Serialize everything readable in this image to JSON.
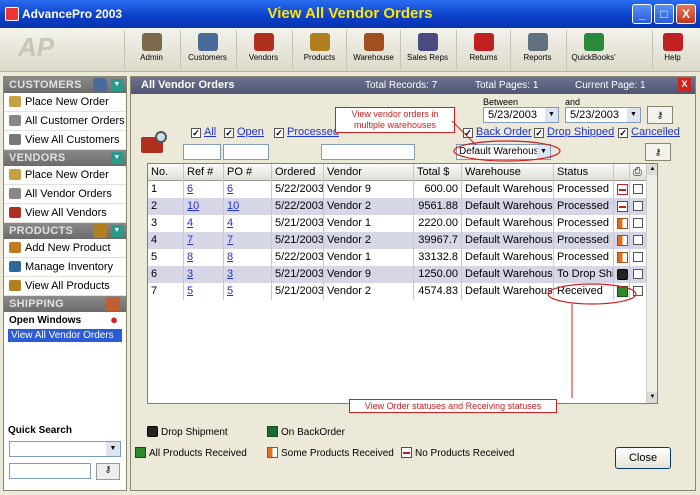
{
  "window": {
    "app_title": "AdvancePro 2003",
    "center_title": "View All Vendor Orders",
    "controls": [
      "_",
      "□",
      "X"
    ]
  },
  "toolbar": {
    "buttons": [
      {
        "label": "Admin",
        "icon": "admin-icon",
        "color": "#7b6a4e"
      },
      {
        "label": "Customers",
        "icon": "customers-icon",
        "color": "#4a6a9a"
      },
      {
        "label": "Vendors",
        "icon": "vendors-icon",
        "color": "#b03020"
      },
      {
        "label": "Products",
        "icon": "products-icon",
        "color": "#b08020"
      },
      {
        "label": "Warehouse",
        "icon": "warehouse-icon",
        "color": "#a05020"
      },
      {
        "label": "Sales Reps",
        "icon": "sales-reps-icon",
        "color": "#4a4a80"
      },
      {
        "label": "Returns",
        "icon": "returns-icon",
        "color": "#c02020"
      },
      {
        "label": "Reports",
        "icon": "reports-icon",
        "color": "#607080"
      },
      {
        "label": "QuickBooks'",
        "icon": "quickbooks-icon",
        "color": "#2a8a3a"
      },
      {
        "label": "Help",
        "icon": "help-icon",
        "color": "#c02020"
      }
    ]
  },
  "sidebar": {
    "customers": {
      "title": "CUSTOMERS",
      "items": [
        "Place New Order",
        "All Customer Orders",
        "View All Customers"
      ]
    },
    "vendors": {
      "title": "VENDORS",
      "items": [
        "Place New Order",
        "All Vendor Orders",
        "View All Vendors"
      ]
    },
    "products": {
      "title": "PRODUCTS",
      "items": [
        "Add New Product",
        "Manage Inventory",
        "View All Products"
      ]
    },
    "shipping": {
      "title": "SHIPPING"
    },
    "open_windows": {
      "title": "Open Windows",
      "items": [
        "View All Vendor Orders"
      ]
    },
    "quick_search": {
      "title": "Quick Search"
    }
  },
  "main": {
    "title": "All Vendor Orders",
    "total_records": "Total Records: 7",
    "total_pages": "Total Pages:  1",
    "current_page": "Current Page:  1",
    "between_label": "Between",
    "and_label": "and",
    "date_from": "5/23/2003",
    "date_to": "5/23/2003",
    "filters": [
      "All",
      "Open",
      "Processed",
      "Back Order",
      "Drop Shipped",
      "Cancelled"
    ],
    "warehouse_select": "Default Warehouse",
    "columns": [
      "No.",
      "Ref #",
      "PO #",
      "Ordered",
      "Vendor",
      "Total $",
      "Warehouse",
      "Status"
    ],
    "rows": [
      {
        "no": "1",
        "ref": "6",
        "po": "6",
        "ordered": "5/22/2003",
        "vendor": "Vendor 9",
        "total": "600.00",
        "warehouse": "Default Warehouse",
        "status": "Processed",
        "icon": "none"
      },
      {
        "no": "2",
        "ref": "10",
        "po": "10",
        "ordered": "5/22/2003",
        "vendor": "Vendor 2",
        "total": "9561.88",
        "warehouse": "Default Warehouse",
        "status": "Processed",
        "icon": "none"
      },
      {
        "no": "3",
        "ref": "4",
        "po": "4",
        "ordered": "5/21/2003",
        "vendor": "Vendor 1",
        "total": "2220.00",
        "warehouse": "Default Warehouse",
        "status": "Processed",
        "icon": "some"
      },
      {
        "no": "4",
        "ref": "7",
        "po": "7",
        "ordered": "5/21/2003",
        "vendor": "Vendor 2",
        "total": "39967.7",
        "warehouse": "Default Warehouse",
        "status": "Processed",
        "icon": "some"
      },
      {
        "no": "5",
        "ref": "8",
        "po": "8",
        "ordered": "5/22/2003",
        "vendor": "Vendor 1",
        "total": "33132.8",
        "warehouse": "Default Warehouse",
        "status": "Processed",
        "icon": "some"
      },
      {
        "no": "6",
        "ref": "3",
        "po": "3",
        "ordered": "5/21/2003",
        "vendor": "Vendor 9",
        "total": "1250.00",
        "warehouse": "Default Warehouse",
        "status": "To Drop Shi",
        "icon": "drop"
      },
      {
        "no": "7",
        "ref": "5",
        "po": "5",
        "ordered": "5/21/2003",
        "vendor": "Vendor 2",
        "total": "4574.83",
        "warehouse": "Default Warehouse",
        "status": "Received",
        "icon": "all"
      }
    ],
    "callout_warehouses": "View vendor orders in multiple warehouses",
    "callout_statuses": "View Order statuses and Receiving statuses",
    "legend": {
      "drop": "Drop Shipment",
      "backorder": "On BackOrder",
      "all": "All Products Received",
      "some": "Some Products Received",
      "none": "No Products Received"
    },
    "close_label": "Close"
  },
  "colors": {
    "title_bar": "#0a3fc8",
    "title_text": "#ffe600",
    "accent": "#d02020",
    "selection": "#2c5bd6"
  }
}
